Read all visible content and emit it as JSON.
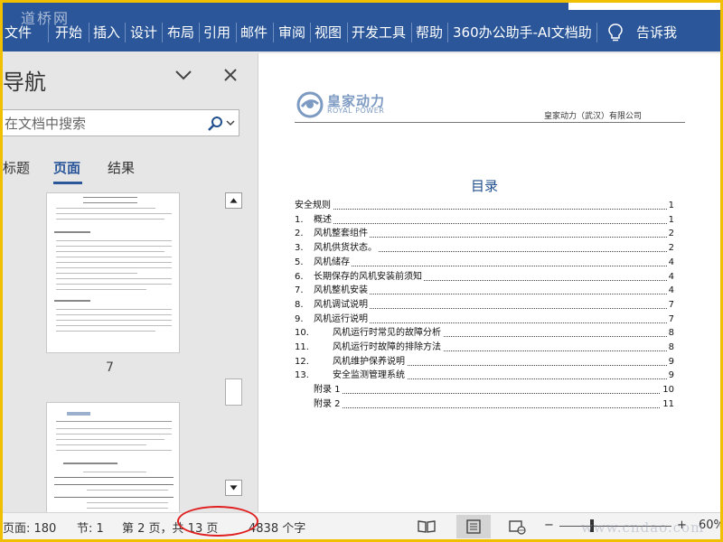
{
  "watermark_top": "道桥网",
  "watermark_bottom": "www.cndao.com",
  "ribbon": {
    "tabs": [
      "文件",
      "开始",
      "插入",
      "设计",
      "布局",
      "引用",
      "邮件",
      "审阅",
      "视图",
      "开发工具",
      "帮助",
      "360办公助手-AI文档助"
    ],
    "tell_me": "告诉我",
    "color": "#2b579a"
  },
  "nav": {
    "title": "导航",
    "search_placeholder": "在文档中搜索",
    "tabs": {
      "headings": "标题",
      "pages": "页面",
      "results": "结果"
    },
    "thumb_page_number": "7"
  },
  "document": {
    "logo_cn": "皇家动力",
    "logo_en": "ROYAL POWER",
    "header_company": "皇家动力（武汉）有限公司",
    "toc_title": "目录",
    "toc": [
      {
        "num": "",
        "text": "安全规则",
        "page": "1",
        "level": 0
      },
      {
        "num": "1.",
        "text": "概述",
        "page": "1",
        "level": 1
      },
      {
        "num": "2.",
        "text": "风机整套组件",
        "page": "2",
        "level": 1
      },
      {
        "num": "3.",
        "text": "风机供货状态。",
        "page": "2",
        "level": 1
      },
      {
        "num": "5.",
        "text": "风机储存",
        "page": "4",
        "level": 1
      },
      {
        "num": "6.",
        "text": "长期保存的风机安装前须知",
        "page": "4",
        "level": 1
      },
      {
        "num": "7.",
        "text": "风机整机安装",
        "page": "4",
        "level": 1
      },
      {
        "num": "8.",
        "text": "风机调试说明",
        "page": "7",
        "level": 1
      },
      {
        "num": "9.",
        "text": "风机运行说明",
        "page": "7",
        "level": 1
      },
      {
        "num": "10.",
        "text": "风机运行时常见的故障分析",
        "page": "8",
        "level": 2
      },
      {
        "num": "11.",
        "text": "风机运行时故障的排除方法",
        "page": "8",
        "level": 2
      },
      {
        "num": "12.",
        "text": "风机维护保养说明",
        "page": "9",
        "level": 2
      },
      {
        "num": "13.",
        "text": "安全监测管理系统",
        "page": "9",
        "level": 2
      },
      {
        "num": "",
        "text": "附录 1",
        "page": "10",
        "level": 1
      },
      {
        "num": "",
        "text": "附录 2",
        "page": "11",
        "level": 1
      }
    ]
  },
  "status": {
    "pages": "页面: 180",
    "section": "节: 1",
    "page_of": "第 2 页，共 13 页",
    "word_count": "4838 个字",
    "zoom": "60%",
    "zoom_minus": "−",
    "zoom_plus": "+"
  }
}
